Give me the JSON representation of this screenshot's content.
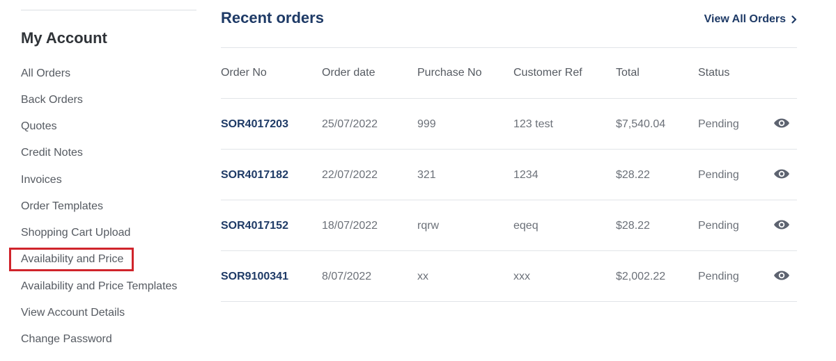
{
  "sidebar": {
    "title": "My Account",
    "items": [
      {
        "label": "All Orders"
      },
      {
        "label": "Back Orders"
      },
      {
        "label": "Quotes"
      },
      {
        "label": "Credit Notes"
      },
      {
        "label": "Invoices"
      },
      {
        "label": "Order Templates"
      },
      {
        "label": "Shopping Cart Upload"
      },
      {
        "label": "Availability and Price",
        "highlighted": true
      },
      {
        "label": "Availability and Price Templates"
      },
      {
        "label": "View Account Details"
      },
      {
        "label": "Change Password"
      }
    ]
  },
  "main": {
    "title": "Recent orders",
    "view_all_label": "View All Orders",
    "headers": [
      "Order No",
      "Order date",
      "Purchase No",
      "Customer Ref",
      "Total",
      "Status"
    ],
    "rows": [
      {
        "order_no": "SOR4017203",
        "order_date": "25/07/2022",
        "purchase_no": "999",
        "customer_ref": "123 test",
        "total": "$7,540.04",
        "status": "Pending"
      },
      {
        "order_no": "SOR4017182",
        "order_date": "22/07/2022",
        "purchase_no": "321",
        "customer_ref": "1234",
        "total": "$28.22",
        "status": "Pending"
      },
      {
        "order_no": "SOR4017152",
        "order_date": "18/07/2022",
        "purchase_no": "rqrw",
        "customer_ref": "eqeq",
        "total": "$28.22",
        "status": "Pending"
      },
      {
        "order_no": "SOR9100341",
        "order_date": "8/07/2022",
        "purchase_no": "xx",
        "customer_ref": "xxx",
        "total": "$2,002.22",
        "status": "Pending"
      }
    ]
  },
  "colors": {
    "accent": "#1e3a66",
    "highlight_border": "#d0242b",
    "divider": "#e1e4e8",
    "icon": "#5d6370"
  },
  "icons": {
    "view_all": "chevron-right-icon",
    "row_action": "eye-icon"
  }
}
